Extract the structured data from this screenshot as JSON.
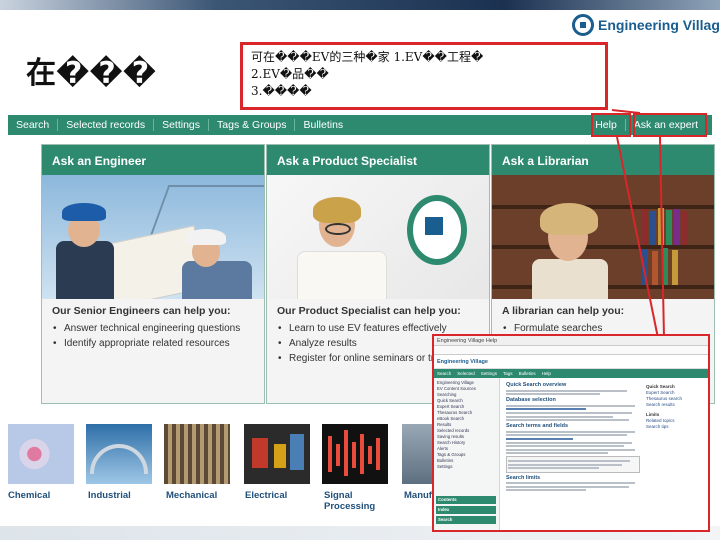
{
  "slide": {
    "title": "在���",
    "callout_lines": [
      "可在���EV的三种�家 1.EV��工程�",
      "2.EV�品��",
      "3.����"
    ]
  },
  "logo": {
    "text": "Engineering Village"
  },
  "nav": {
    "left_items": [
      "Search",
      "Selected records",
      "Settings",
      "Tags & Groups",
      "Bulletins"
    ],
    "right_items": [
      "Help",
      "Ask an expert"
    ]
  },
  "panels": [
    {
      "title": "Ask an Engineer",
      "lead": "Our Senior Engineers can help you:",
      "items": [
        "Answer technical engineering questions",
        "Identify appropriate related resources"
      ]
    },
    {
      "title": "Ask a Product Specialist",
      "lead": "Our Product Specialist can help you:",
      "items": [
        "Learn to use EV features effectively",
        "Analyze results",
        "Register for online seminars or trainings"
      ]
    },
    {
      "title": "Ask a Librarian",
      "lead": "A librarian can help you:",
      "items": [
        "Formulate searches"
      ]
    }
  ],
  "categories": [
    "Chemical",
    "Industrial",
    "Mechanical",
    "Electrical",
    "Signal\nProcessing",
    "Manuf"
  ],
  "screenshot": {
    "window_title": "Engineering Village Help",
    "url": "",
    "logo_text": "Engineering Village",
    "nav_items": [
      "Search",
      "Selected",
      "Settings",
      "Tags",
      "Bulletins",
      "Help"
    ],
    "main_heading": "Quick Search overview",
    "sub_heading_1": "Database selection",
    "sub_heading_2": "Search terms and fields",
    "sub_heading_3": "Search limits",
    "side_items": [
      "Engineering Village",
      "EV Content Sources",
      "Searching",
      "Quick Search",
      "Expert Search",
      "Thesaurus Search",
      "eBook Search",
      "Results",
      "Selected records",
      "Saving results",
      "Search History",
      "Alerts",
      "Tags & Groups",
      "Bulletins",
      "Settings"
    ],
    "side_buttons": [
      "Contents",
      "Index",
      "Search"
    ],
    "right_items": [
      "Quick Search",
      "Expert Search",
      "Thesaurus search",
      "Search results",
      "Limits",
      "Related topics",
      "Search tips"
    ]
  }
}
